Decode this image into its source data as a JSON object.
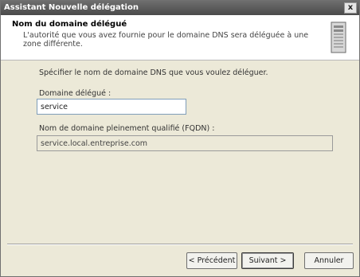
{
  "window": {
    "title": "Assistant Nouvelle délégation",
    "close_label": "x"
  },
  "header": {
    "title": "Nom du domaine délégué",
    "description": "L'autorité que vous avez fournie pour le domaine DNS sera déléguée à une zone différente.",
    "icon": "server-icon"
  },
  "content": {
    "instruction": "Spécifier le nom de domaine DNS que vous voulez déléguer.",
    "delegated_domain_label": "Domaine délégué :",
    "delegated_domain_value": "service",
    "fqdn_label": "Nom de domaine pleinement qualifié (FQDN) :",
    "fqdn_value": "service.local.entreprise.com"
  },
  "buttons": {
    "previous": "< Précédent",
    "next": "Suivant >",
    "cancel": "Annuler"
  }
}
